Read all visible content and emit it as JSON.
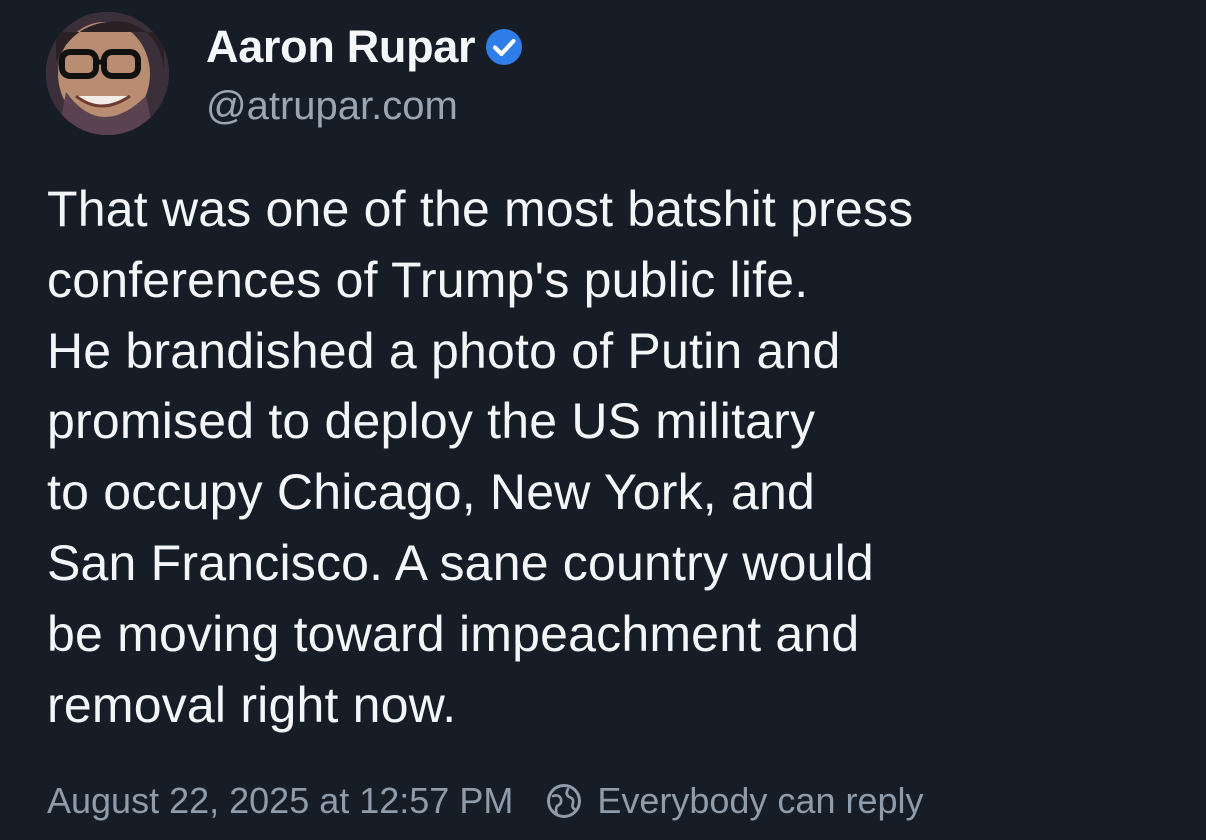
{
  "author": {
    "display_name": "Aaron Rupar",
    "handle": "@atrupar.com",
    "verified": true,
    "verified_icon": "verified-check-icon",
    "verified_color": "#2f7de8"
  },
  "post": {
    "lines": [
      "That was one of the most batshit press",
      "conferences of Trump's public life.",
      "He brandished a photo of Putin and",
      "promised to deploy the US military",
      "to occupy Chicago, New York, and",
      "San Francisco. A sane country would",
      "be moving toward impeachment and",
      "removal right now."
    ]
  },
  "meta": {
    "timestamp": "August 22, 2025 at 12:57 PM",
    "reply_setting": "Everybody can reply",
    "reply_icon": "globe-icon"
  },
  "colors": {
    "background": "#171d26",
    "text": "#f3f5f7",
    "muted": "#8f9cab"
  }
}
